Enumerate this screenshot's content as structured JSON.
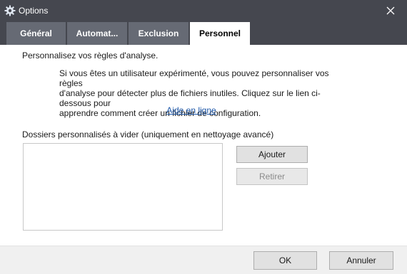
{
  "window": {
    "title": "Options",
    "icon": "gear-icon",
    "close_icon": "close-icon"
  },
  "tabs": [
    {
      "label": "Général",
      "active": false
    },
    {
      "label": "Automat...",
      "active": false
    },
    {
      "label": "Exclusion",
      "active": false
    },
    {
      "label": "Personnel",
      "active": true
    }
  ],
  "panel": {
    "heading": "Personnalisez vos règles d'analyse.",
    "description": "Si vous êtes un utilisateur expérimenté, vous pouvez personnaliser vos règles\nd'analyse pour détecter plus de fichiers inutiles. Cliquez sur le lien ci-dessous pour\napprendre comment créer un fichier de configuration.",
    "help_link": "Aide en ligne",
    "folders_label": "Dossiers personnalisés à vider (uniquement en nettoyage avancé)",
    "add_button": "Ajouter",
    "remove_button": "Retirer"
  },
  "footer": {
    "ok_button": "OK",
    "cancel_button": "Annuler"
  },
  "colors": {
    "titlebar": "#45474f",
    "tab_inactive": "#666a74",
    "tab_active": "#ffffff",
    "link": "#1a55a8"
  }
}
